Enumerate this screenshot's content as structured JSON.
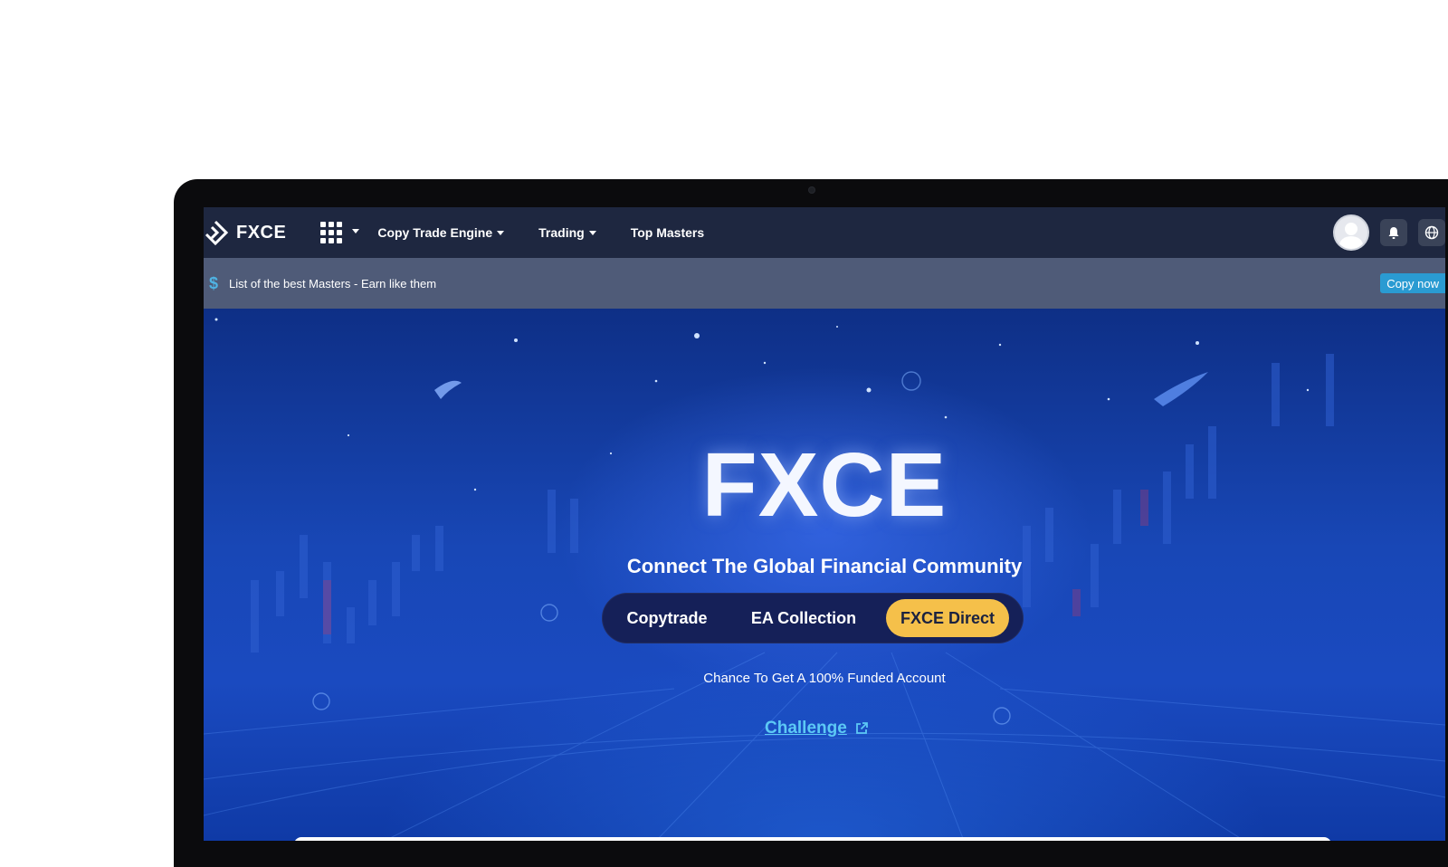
{
  "nav": {
    "brand": "FXCE",
    "items": [
      {
        "label": "Copy Trade Engine",
        "has_caret": true
      },
      {
        "label": "Trading",
        "has_caret": true
      },
      {
        "label": "Top Masters",
        "has_caret": false
      }
    ]
  },
  "banner": {
    "text": "List of the best Masters - Earn like them",
    "button": "Copy now"
  },
  "hero": {
    "title": "FXCE",
    "subtitle": "Connect The Global Financial Community",
    "tabs": [
      {
        "label": "Copytrade",
        "active": false
      },
      {
        "label": "EA Collection",
        "active": false
      },
      {
        "label": "FXCE Direct",
        "active": true
      }
    ],
    "tagline": "Chance To Get A 100% Funded Account",
    "link": "Challenge"
  },
  "colors": {
    "nav_bg": "#1e2740",
    "banner_bg": "#4f5b78",
    "accent_yellow": "#f5c04a",
    "link_blue": "#5cc9f5",
    "button_blue": "#2a9bd2"
  },
  "icons": [
    "fxce-logo-icon",
    "apps-grid-icon",
    "user-avatar-icon",
    "bell-icon",
    "globe-icon",
    "dollar-icon",
    "external-link-icon"
  ]
}
